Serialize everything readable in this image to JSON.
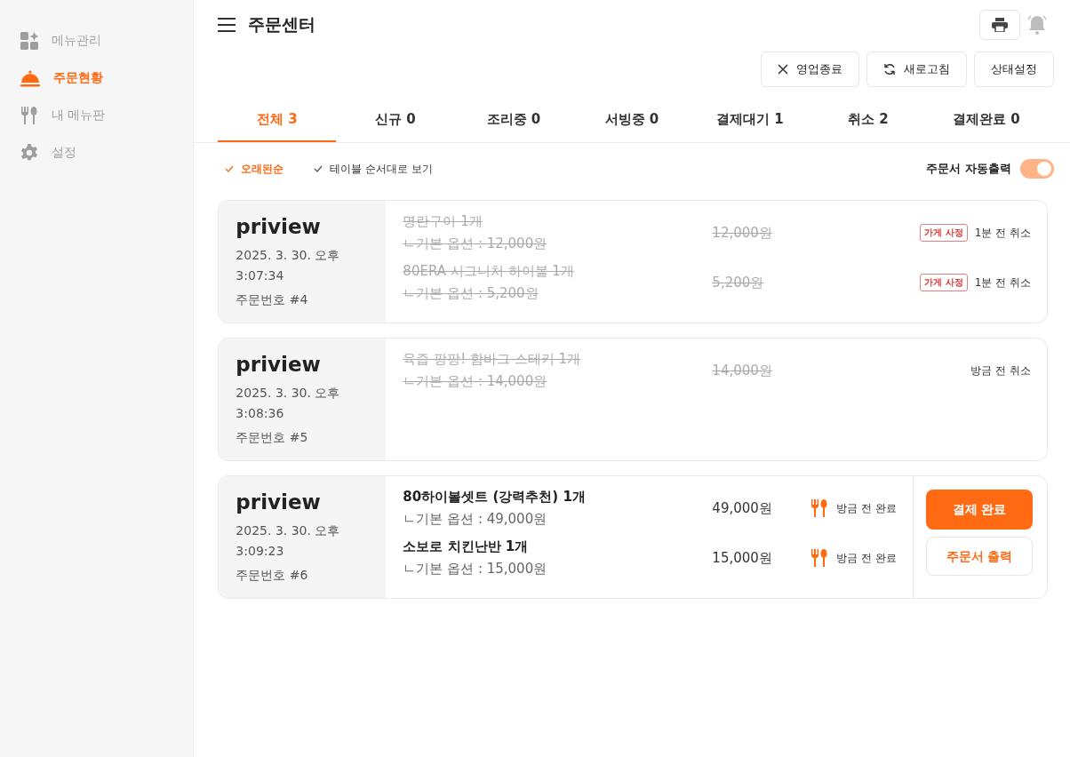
{
  "sidebar": {
    "items": [
      {
        "kind": "grid",
        "label": "메뉴관리",
        "selected": false
      },
      {
        "kind": "cloche",
        "label": "주문현황",
        "selected": true
      },
      {
        "kind": "utensils",
        "label": "내 메뉴판",
        "selected": false
      },
      {
        "kind": "gear",
        "label": "설정",
        "selected": false
      }
    ]
  },
  "header": {
    "title": "주문센터"
  },
  "actions": [
    {
      "kind": "close",
      "label": "영업종료"
    },
    {
      "kind": "refresh",
      "label": "새로고침"
    },
    {
      "kind": "plain",
      "label": "상태설정"
    }
  ],
  "tabs": [
    {
      "label": "전체 3",
      "selected": true
    },
    {
      "label": "신규 0",
      "selected": false
    },
    {
      "label": "조리중 0",
      "selected": false
    },
    {
      "label": "서빙중 0",
      "selected": false
    },
    {
      "label": "결제대기 1",
      "selected": false
    },
    {
      "label": "취소 2",
      "selected": false
    },
    {
      "label": "결제완료 0",
      "selected": false
    }
  ],
  "sort_options": [
    {
      "label": "오래된순",
      "selected": true
    },
    {
      "label": "테이블 순서대로 보기",
      "selected": false
    }
  ],
  "auto_print": {
    "label": "주문서 자동출력",
    "on": true
  },
  "orders": [
    {
      "name": "priview",
      "datetime": "2025. 3. 30. 오후 3:07:34",
      "order_no": "주문번호 #4",
      "items": [
        {
          "name": "명란구이 1개",
          "option": "ㄴ기본 옵션 : 12,000원",
          "price": "12,000원",
          "canceled": true,
          "badge": "가게 사정",
          "status": "1분 전 취소",
          "kind": "canceled"
        },
        {
          "name": "80ERA 시그니처 하이볼 1개",
          "option": "ㄴ기본 옵션 : 5,200원",
          "price": "5,200원",
          "canceled": true,
          "badge": "가게 사정",
          "status": "1분 전 취소",
          "kind": "canceled"
        }
      ]
    },
    {
      "name": "priview",
      "datetime": "2025. 3. 30. 오후 3:08:36",
      "order_no": "주문번호 #5",
      "items": [
        {
          "name": "육즙 팡팡! 함바그 스테키 1개",
          "option": "ㄴ기본 옵션 : 14,000원",
          "price": "14,000원",
          "canceled": true,
          "status": "방금 전 취소",
          "kind": "canceled"
        }
      ]
    },
    {
      "name": "priview",
      "datetime": "2025. 3. 30. 오후 3:09:23",
      "order_no": "주문번호 #6",
      "items": [
        {
          "name": "80하이볼셋트 (강력추천) 1개",
          "option": "ㄴ기본 옵션 : 49,000원",
          "price": "49,000원",
          "canceled": false,
          "status": "방금 전 완료",
          "kind": "done"
        },
        {
          "name": "소보로 치킨난반 1개",
          "option": "ㄴ기본 옵션 : 15,000원",
          "price": "15,000원",
          "canceled": false,
          "status": "방금 전 완료",
          "kind": "done"
        }
      ],
      "buttons": [
        {
          "label": "결제 완료",
          "kind": "primary"
        },
        {
          "label": "주문서 출력",
          "kind": "outline"
        }
      ]
    }
  ]
}
